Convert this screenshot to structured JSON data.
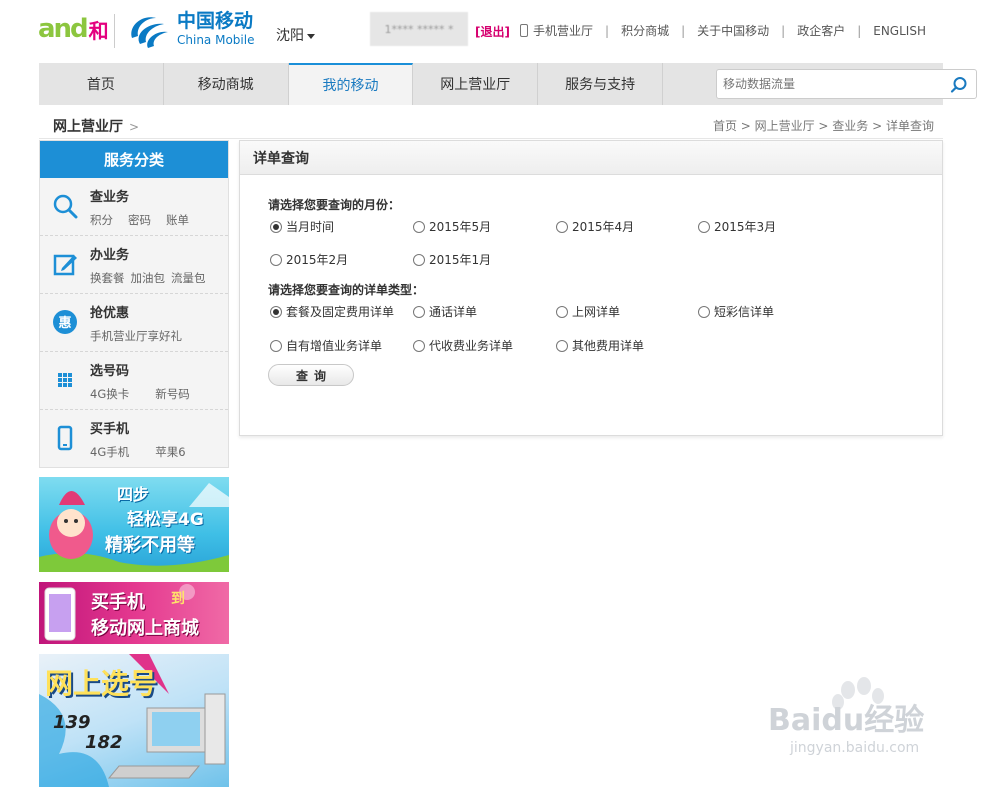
{
  "header": {
    "and_logo_text": "and",
    "and_logo_char": "和",
    "cm_cn": "中国移动",
    "cm_en": "China Mobile",
    "city": "沈阳",
    "user_masked": "1**** ***** *",
    "logout": "[退出]",
    "links": [
      "手机营业厅",
      "积分商城",
      "关于中国移动",
      "政企客户",
      "ENGLISH"
    ]
  },
  "nav": {
    "items": [
      "首页",
      "移动商城",
      "我的移动",
      "网上营业厅",
      "服务与支持"
    ],
    "active": "我的移动",
    "search_placeholder": "移动数据流量"
  },
  "breadcrumb": {
    "section": "网上营业厅",
    "gt": ">",
    "path": "首页 > 网上营业厅 > 查业务 > 详单查询"
  },
  "sidebar": {
    "title": "服务分类",
    "items": [
      {
        "title": "查业务",
        "subs": [
          "积分",
          "密码",
          "账单"
        ],
        "icon": "search-icon"
      },
      {
        "title": "办业务",
        "subs": [
          "换套餐",
          "加油包",
          "流量包"
        ],
        "icon": "edit-icon"
      },
      {
        "title": "抢优惠",
        "subs": [
          "手机营业厅享好礼"
        ],
        "icon": "discount-icon"
      },
      {
        "title": "选号码",
        "subs": [
          "4G换卡",
          "新号码"
        ],
        "icon": "grid-icon"
      },
      {
        "title": "买手机",
        "subs": [
          "4G手机",
          "苹果6"
        ],
        "icon": "phone-icon"
      }
    ]
  },
  "banners": {
    "b1_line1": "四步",
    "b1_line2": "轻松享4G",
    "b1_line3": "精彩不用等",
    "b2_line1": "买手机",
    "b2_line2": "移动网上商城",
    "b2_badge": "到",
    "b3_title": "网上选号",
    "b3_num1": "139",
    "b3_num2": "182"
  },
  "panel": {
    "title": "详单查询",
    "month_label": "请选择您要查询的月份：",
    "months": [
      "当月时间",
      "2015年5月",
      "2015年4月",
      "2015年3月",
      "2015年2月",
      "2015年1月"
    ],
    "month_selected": "当月时间",
    "type_label": "请选择您要查询的详单类型：",
    "types": [
      "套餐及固定费用详单",
      "通话详单",
      "上网详单",
      "短彩信详单",
      "自有增值业务详单",
      "代收费业务详单",
      "其他费用详单"
    ],
    "type_selected": "套餐及固定费用详单",
    "button": "查询"
  },
  "watermark": {
    "brand": "Baidu经验",
    "url": "jingyan.baidu.com"
  },
  "colors": {
    "brand_blue": "#1d8fd6",
    "logout_pink": "#d6006f",
    "and_green": "#8cc63f",
    "and_pink": "#e4007f"
  }
}
